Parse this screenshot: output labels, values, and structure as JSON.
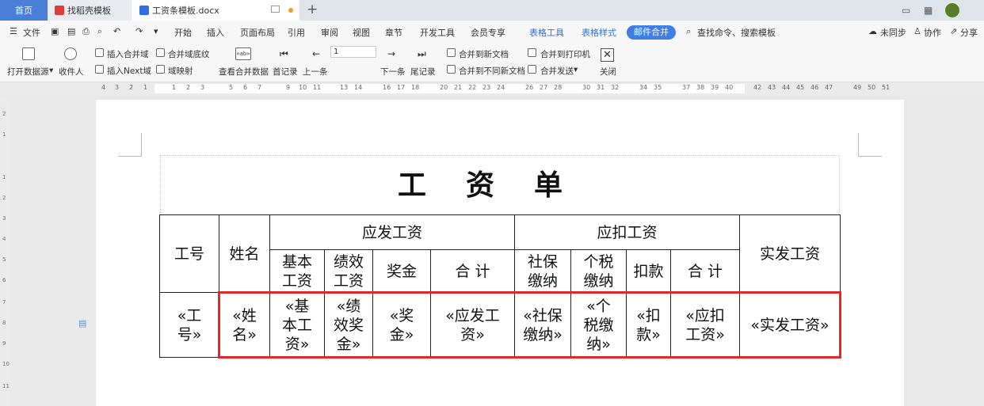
{
  "tabs": {
    "home": "首页",
    "template": "找稻壳模板",
    "doc": "工资条模板.docx"
  },
  "menu": {
    "file": "文件",
    "items": [
      "开始",
      "插入",
      "页面布局",
      "引用",
      "审阅",
      "视图",
      "章节",
      "开发工具",
      "会员专享"
    ],
    "table_tools": "表格工具",
    "table_style": "表格样式",
    "mail_merge": "邮件合并",
    "search": "查找命令、搜索模板",
    "unsync": "未同步",
    "collab": "协作",
    "share": "分享"
  },
  "ribbon": {
    "open_source": "打开数据源",
    "recipients": "收件人",
    "insert_field": "插入合并域",
    "merge_shading": "合并域底纹",
    "insert_next": "插入Next域",
    "field_map": "域映射",
    "view_data": "查看合并数据",
    "first": "首记录",
    "prev": "上一条",
    "record_value": "1",
    "next": "下一条",
    "last": "尾记录",
    "merge_new_doc": "合并到新文档",
    "merge_diff_doc": "合并到不同新文档",
    "merge_printer": "合并到打印机",
    "merge_send": "合并发送",
    "close": "关闭"
  },
  "ruler": [
    "4",
    "3",
    "2",
    "1",
    "1",
    "2",
    "3",
    "5",
    "6",
    "7",
    "9",
    "10",
    "11",
    "13",
    "14",
    "16",
    "17",
    "18",
    "20",
    "21",
    "22",
    "23",
    "24",
    "26",
    "27",
    "28",
    "30",
    "31",
    "32",
    "34",
    "35",
    "37",
    "38",
    "39",
    "40",
    "42",
    "43",
    "44",
    "45",
    "46",
    "47",
    "49",
    "50",
    "51"
  ],
  "vruler": [
    "2",
    "1",
    "1",
    "2",
    "3",
    "4",
    "5",
    "6",
    "7",
    "8",
    "9",
    "10",
    "11"
  ],
  "document": {
    "title": "工资单",
    "headers": {
      "id": "工号",
      "name": "姓名",
      "gross": "应发工资",
      "deduct": "应扣工资",
      "net": "实发工资",
      "basic": "基本工资",
      "perf": "绩效工资",
      "bonus": "奖金",
      "total1": "合 计",
      "social": "社保缴纳",
      "tax": "个税缴纳",
      "cut": "扣款",
      "total2": "合 计"
    },
    "fields": {
      "id": "«工号»",
      "name": "«姓名»",
      "basic": "«基本工资»",
      "perf": "«绩效奖金»",
      "bonus": "«奖金»",
      "gross": "«应发工资»",
      "social": "«社保缴纳»",
      "tax": "«个税缴纳»",
      "cut": "«扣款»",
      "deduct": "«应扣工资»",
      "net": "«实发工资»"
    }
  }
}
